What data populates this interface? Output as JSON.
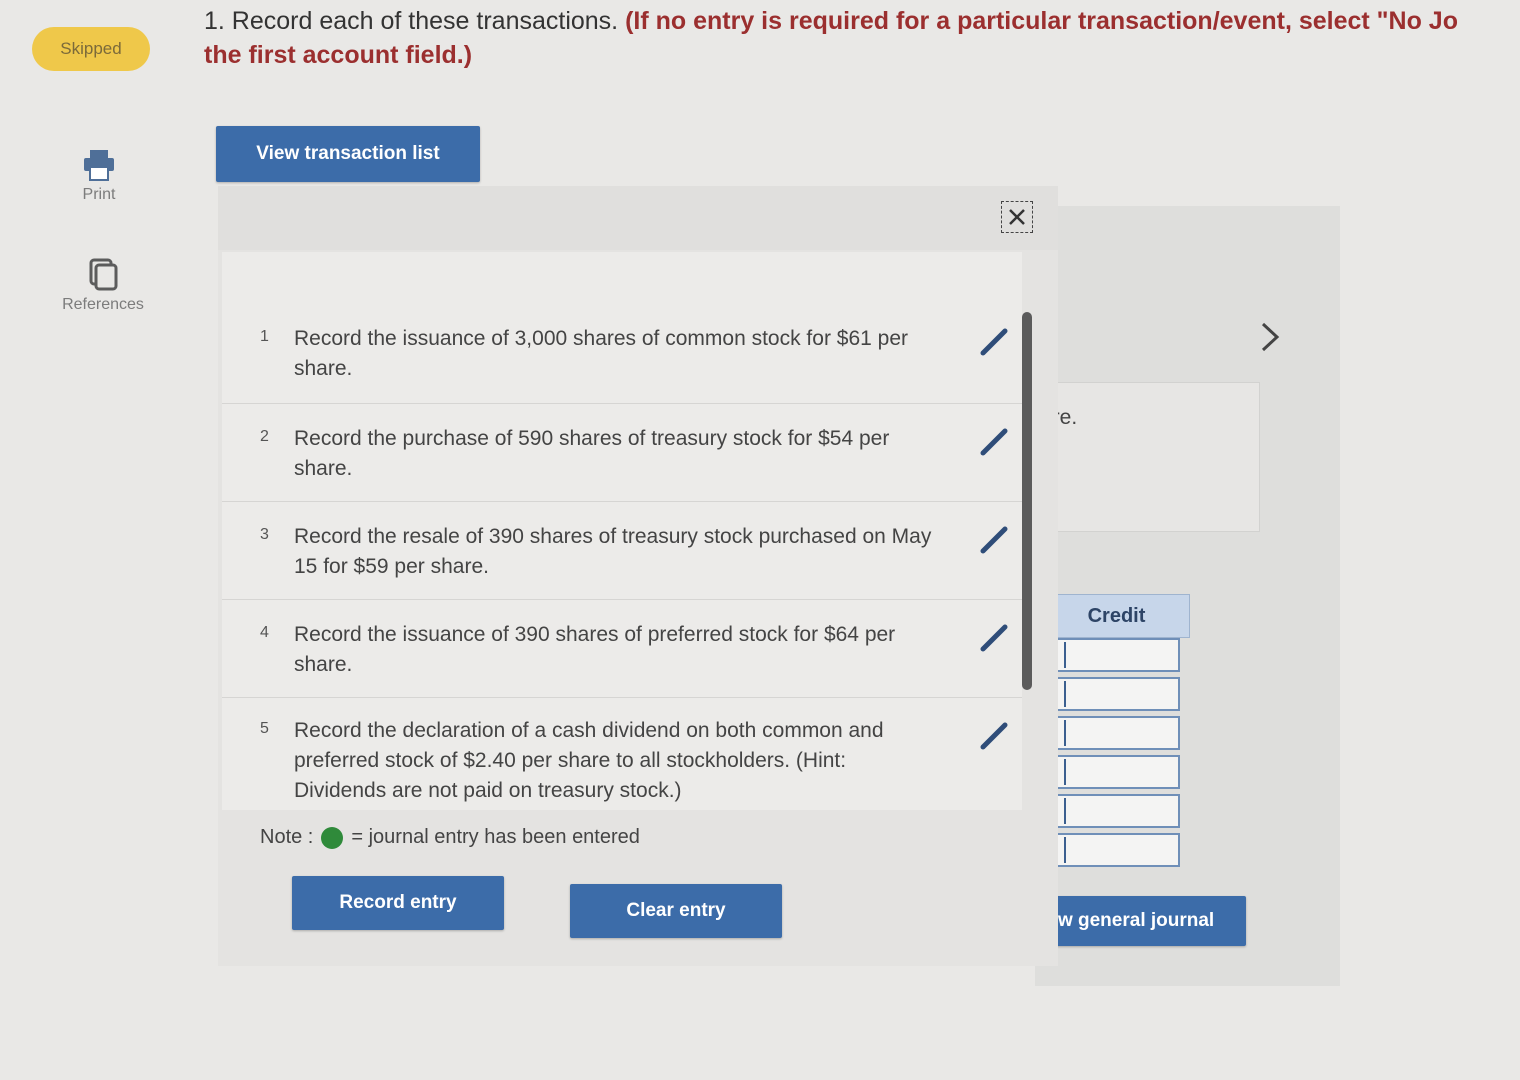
{
  "sidebar": {
    "status_badge": "Skipped",
    "print_label": "Print",
    "references_label": "References"
  },
  "question": {
    "number_text": "1. Record each of these transactions.",
    "instruction": "(If no entry is required for a particular transaction/event, select \"No Jo",
    "instruction_line2": "the first account field.)"
  },
  "toolbar": {
    "view_transaction_list": "View transaction list"
  },
  "popup": {
    "transactions": [
      {
        "num": "1",
        "text": "Record the issuance of 3,000 shares of common stock for $61 per share."
      },
      {
        "num": "2",
        "text": "Record the purchase of 590 shares of treasury stock for $54 per share."
      },
      {
        "num": "3",
        "text": "Record the resale of 390 shares of treasury stock purchased on May 15 for $59 per share."
      },
      {
        "num": "4",
        "text": "Record the issuance of 390 shares of preferred stock for $64 per share."
      },
      {
        "num": "5",
        "text": "Record the declaration of a cash dividend on both common and preferred stock of $2.40 per share to all stockholders. (Hint: Dividends are not paid on treasury stock.)"
      }
    ],
    "note_prefix": "Note :",
    "note_suffix": "= journal entry has been entered",
    "record_entry": "Record entry",
    "clear_entry": "Clear entry"
  },
  "journal": {
    "partial_text": "ire.",
    "credit_header": "Credit",
    "view_general_journal": "View general journal"
  },
  "colors": {
    "button_blue": "#3c6ca9",
    "badge_yellow": "#efc84a",
    "entered_green": "#2f8a3a",
    "instruction_red": "#9b2f2f"
  }
}
